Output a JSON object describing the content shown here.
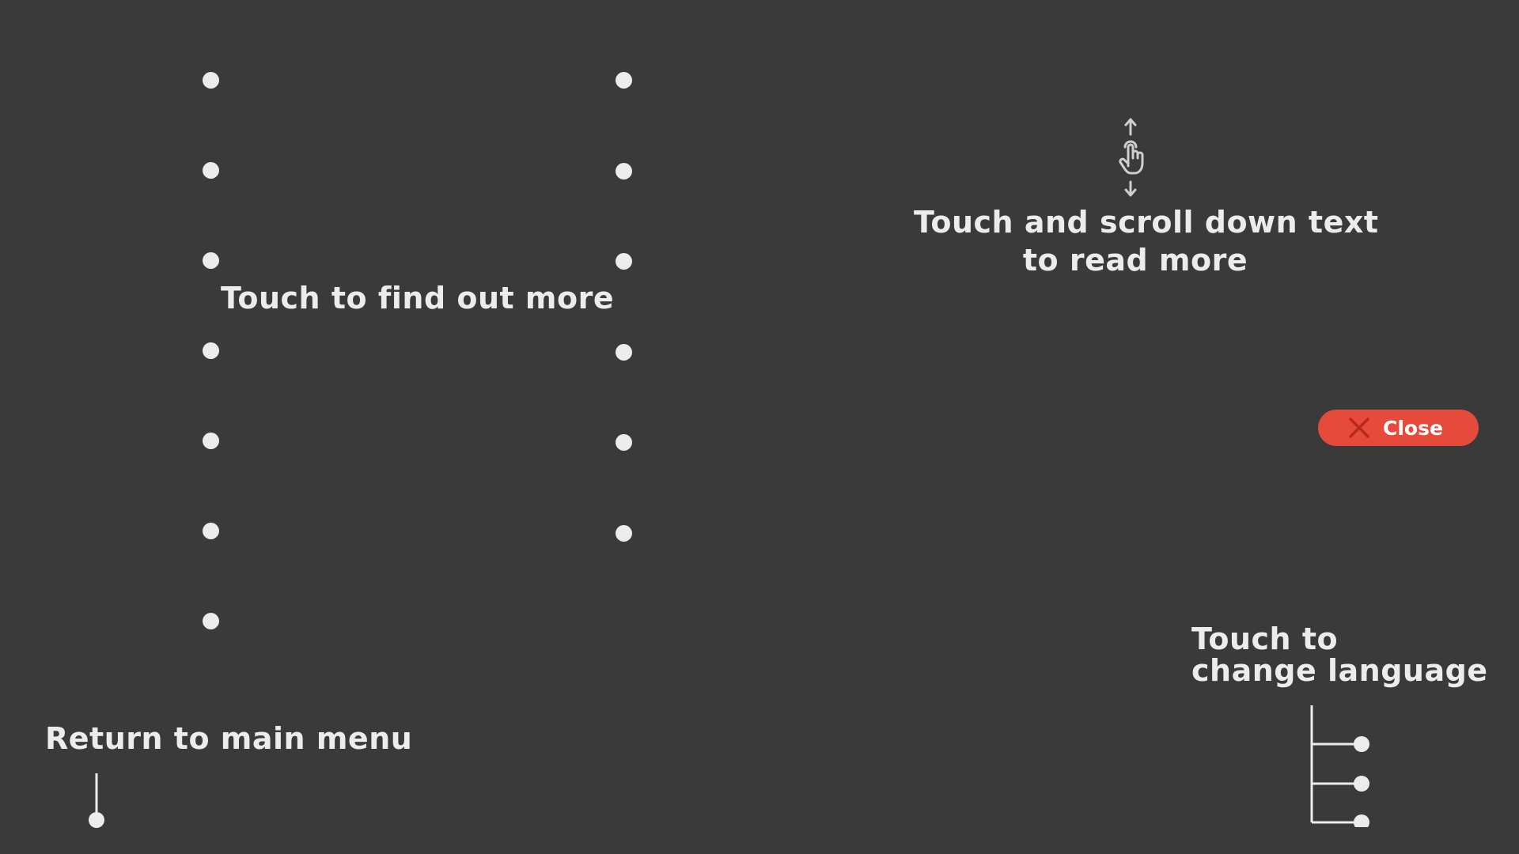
{
  "labels": {
    "find_more": "Touch to find out more",
    "scroll_line1": "Touch and scroll down text",
    "scroll_line2": "to read more",
    "return_menu": "Return to main menu",
    "language_line1": "Touch to",
    "language_line2": "change language"
  },
  "close_button": {
    "label": "Close"
  },
  "dot_columns": [
    {
      "name": "left",
      "count": 7
    },
    {
      "name": "right",
      "count": 6
    }
  ],
  "language_options_count": 3,
  "icons": {
    "scroll": "scroll-finger-icon",
    "close": "close-x-icon",
    "return": "pin-icon",
    "language": "tree-branches-icon"
  },
  "colors": {
    "background": "#3a3a3a",
    "foreground": "#ececec",
    "accent": "#e64a3b"
  }
}
